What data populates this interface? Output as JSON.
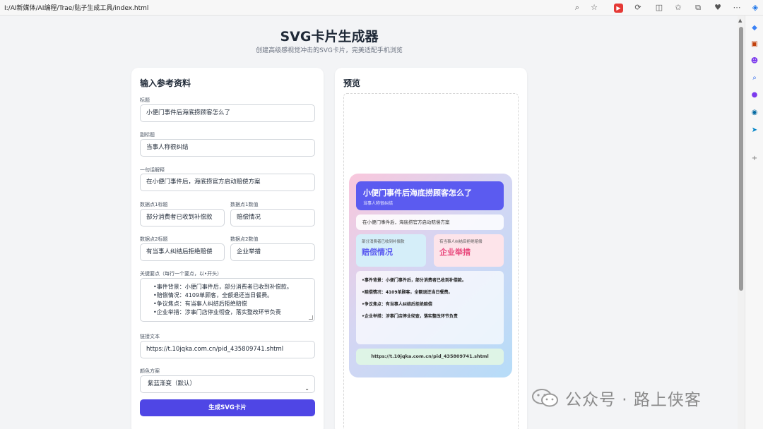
{
  "browser": {
    "address": "I:/AI新媒体/AI编程/Trae/贴子生成工具/index.html"
  },
  "page": {
    "title": "SVG卡片生成器",
    "subtitle": "创建高级感视觉冲击的SVG卡片，完美适配手机浏览"
  },
  "form": {
    "heading": "输入参考资料",
    "title_label": "标题",
    "title_value": "小便门事件后海底捞顾客怎么了",
    "subtitle_label": "副标题",
    "subtitle_value": "当事人称很纠结",
    "explain_label": "一句话解释",
    "explain_value": "在小便门事件后，海底捞官方启动赔偿方案",
    "dp1_title_label": "数据点1标题",
    "dp1_title_value": "部分消费者已收到补偿款",
    "dp1_value_label": "数据点1数值",
    "dp1_value_value": "赔偿情况",
    "dp2_title_label": "数据点2标题",
    "dp2_title_value": "有当事人纠结后拒绝赔偿",
    "dp2_value_label": "数据点2数值",
    "dp2_value_value": "企业举措",
    "points_label": "关键要点（每行一个要点，以•开头）",
    "points": [
      "•事件背景：小便门事件后，部分消费者已收到补偿款。",
      "•赔偿情况：4109单顾客，全额退还当日餐费。",
      "•争议焦点：有当事人纠结后拒绝赔偿",
      "•企业举措：涉事门店停业彻查，落实整改环节负责"
    ],
    "link_label": "链接文本",
    "link_value": "https://t.10jqka.com.cn/pid_435809741.shtml",
    "color_label": "颜色方案",
    "color_value": "紫蓝渐变（默认）",
    "generate_label": "生成SVG卡片"
  },
  "preview": {
    "heading": "预览",
    "card": {
      "title": "小便门事件后海底捞顾客怎么了",
      "subtitle": "当事人称很纠结",
      "explain": "在小便门事件后，海底捞官方启动赔偿方案",
      "dp1_label": "部分消费者已收到补偿款",
      "dp1_value": "赔偿情况",
      "dp2_label": "有当事人纠结后拒绝赔偿",
      "dp2_value": "企业举措",
      "points": [
        "•事件背景：小便门事件后，部分消费者已收到补偿款。",
        "•赔偿情况：4109单顾客，全额退还当日餐费。",
        "•争议焦点：有当事人纠结后拒绝赔偿",
        "•企业举措：涉事门店停业彻查，落实整改环节负责"
      ],
      "link": "https://t.10jqka.com.cn/pid_435809741.shtml"
    }
  },
  "watermark": {
    "text": "公众号 · 路上侠客"
  },
  "colors": {
    "accent": "#4f46e5",
    "card_title_bg": "#5b5bf0",
    "dp1_value": "#5b5bf0",
    "dp2_value": "#e8457a"
  }
}
